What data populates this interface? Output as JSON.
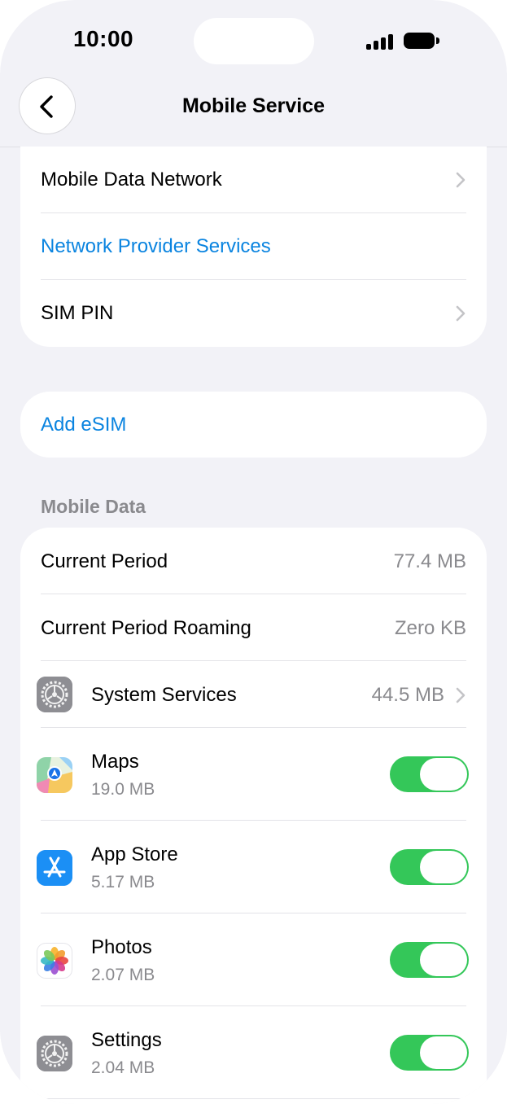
{
  "status_bar": {
    "time": "10:00"
  },
  "nav": {
    "title": "Mobile Service",
    "back_icon": "chevron-left-icon"
  },
  "group1": [
    {
      "label": "Mobile Data Network",
      "style": "default",
      "chevron": true
    },
    {
      "label": "Network Provider Services",
      "style": "link",
      "chevron": false
    },
    {
      "label": "SIM PIN",
      "style": "default",
      "chevron": true
    }
  ],
  "group2": {
    "label": "Add eSIM"
  },
  "mobile_data": {
    "header": "Mobile Data",
    "current_period": {
      "label": "Current Period",
      "value": "77.4 MB"
    },
    "current_period_roaming": {
      "label": "Current Period Roaming",
      "value": "Zero KB"
    },
    "system_services": {
      "label": "System Services",
      "value": "44.5 MB",
      "icon": "settings-gear-icon"
    },
    "apps": [
      {
        "name": "Maps",
        "usage": "19.0 MB",
        "icon": "maps-app-icon",
        "enabled": true
      },
      {
        "name": "App Store",
        "usage": "5.17 MB",
        "icon": "app-store-icon",
        "enabled": true
      },
      {
        "name": "Photos",
        "usage": "2.07 MB",
        "icon": "photos-app-icon",
        "enabled": true
      },
      {
        "name": "Settings",
        "usage": "2.04 MB",
        "icon": "settings-app-icon",
        "enabled": true
      }
    ]
  },
  "colors": {
    "link": "#0a84e0",
    "toggle_on": "#34c759",
    "background": "#f2f2f7"
  }
}
